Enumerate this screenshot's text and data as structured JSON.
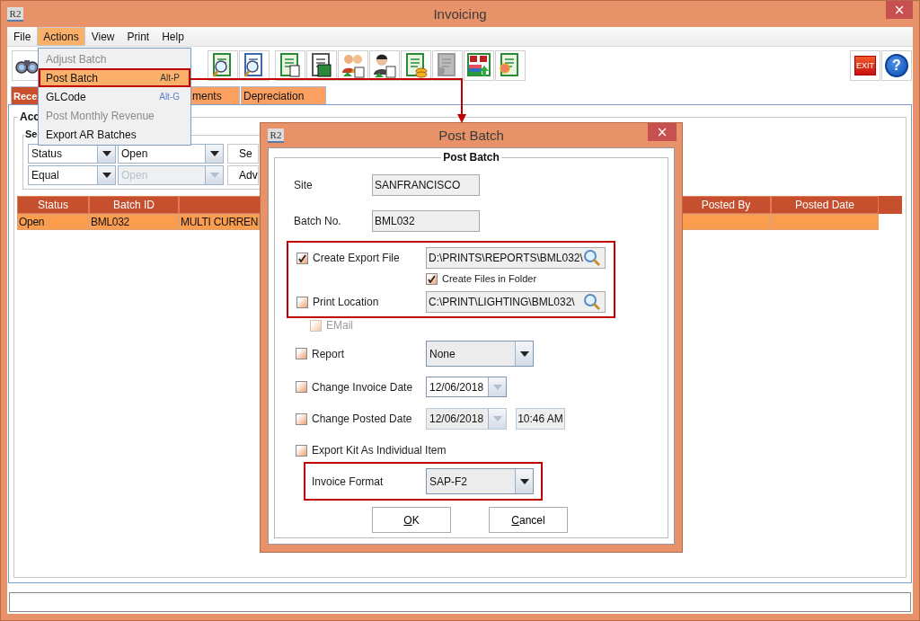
{
  "window": {
    "logo": "R2",
    "title": "Invoicing",
    "close": "×"
  },
  "menu_bar": [
    {
      "label": "File",
      "selected": false
    },
    {
      "label": "Actions",
      "selected": true
    },
    {
      "label": "View",
      "selected": false
    },
    {
      "label": "Print",
      "selected": false
    },
    {
      "label": "Help",
      "selected": false
    }
  ],
  "actions_menu": [
    {
      "label": "Adjust Batch",
      "disabled": true,
      "selected": false,
      "highlighted": false
    },
    {
      "label": "Post Batch",
      "shortcut": "Alt-P",
      "disabled": false,
      "selected": true,
      "highlighted": true
    },
    {
      "label": "GLCode",
      "shortcut": "Alt-G",
      "disabled": false,
      "selected": false,
      "highlighted": false
    },
    {
      "label": "Post Monthly Revenue",
      "disabled": true,
      "selected": false,
      "highlighted": false
    },
    {
      "label": "Export AR Batches",
      "disabled": false,
      "selected": false,
      "highlighted": false
    }
  ],
  "toolbar": {
    "exit_label": "EXIT",
    "help_label": "?"
  },
  "tabs": [
    {
      "label": "Rece",
      "selected": true
    },
    {
      "label": "ments",
      "selected": false
    },
    {
      "label": "Depreciation",
      "selected": false
    }
  ],
  "account_group": {
    "title": "Acc"
  },
  "search_group": {
    "title": "Se"
  },
  "filters": [
    {
      "field": "Status",
      "value": "Open",
      "value_disabled": false,
      "button": "Se"
    },
    {
      "field": "Equal",
      "value": "Open",
      "value_disabled": true,
      "button": "Adv"
    }
  ],
  "table": {
    "columns_left": [
      "Status",
      "Batch ID"
    ],
    "columns_right": [
      "Posted By",
      "Posted Date"
    ],
    "rows": [
      {
        "selected": true,
        "cells_left": [
          "Open",
          "BML032",
          "MULTI CURREN"
        ]
      }
    ]
  },
  "dialog": {
    "logo": "R2",
    "title": "Post Batch",
    "close": "×",
    "group_title": "Post Batch",
    "site": {
      "label": "Site",
      "value": "SANFRANCISCO"
    },
    "batch_no": {
      "label": "Batch No.",
      "value": "BML032"
    },
    "paths_highlighted": true,
    "export_file": {
      "label": "Create Export File",
      "checked": true,
      "path": "D:\\PRINTS\\REPORTS\\BML032\\"
    },
    "create_files_in_folder": {
      "label": "Create Files in Folder",
      "checked": true
    },
    "print_location": {
      "label": "Print Location",
      "checked": false,
      "path": "C:\\PRINT\\LIGHTING\\BML032\\"
    },
    "email": {
      "label": "EMail",
      "checked": false,
      "disabled": true
    },
    "report": {
      "label": "Report",
      "checked": false,
      "value": "None"
    },
    "change_invoice_date": {
      "label": "Change Invoice Date",
      "checked": false,
      "date": "12/06/2018"
    },
    "change_posted_date": {
      "label": "Change Posted Date",
      "checked": false,
      "date": "12/06/2018",
      "time": "10:46 AM"
    },
    "export_kit": {
      "label": "Export Kit As Individual Item",
      "checked": false
    },
    "invoice_format_highlighted": true,
    "invoice_format": {
      "label": "Invoice Format",
      "value": "SAP-F2"
    },
    "buttons": [
      {
        "label": "OK"
      },
      {
        "label": "Cancel"
      }
    ]
  }
}
